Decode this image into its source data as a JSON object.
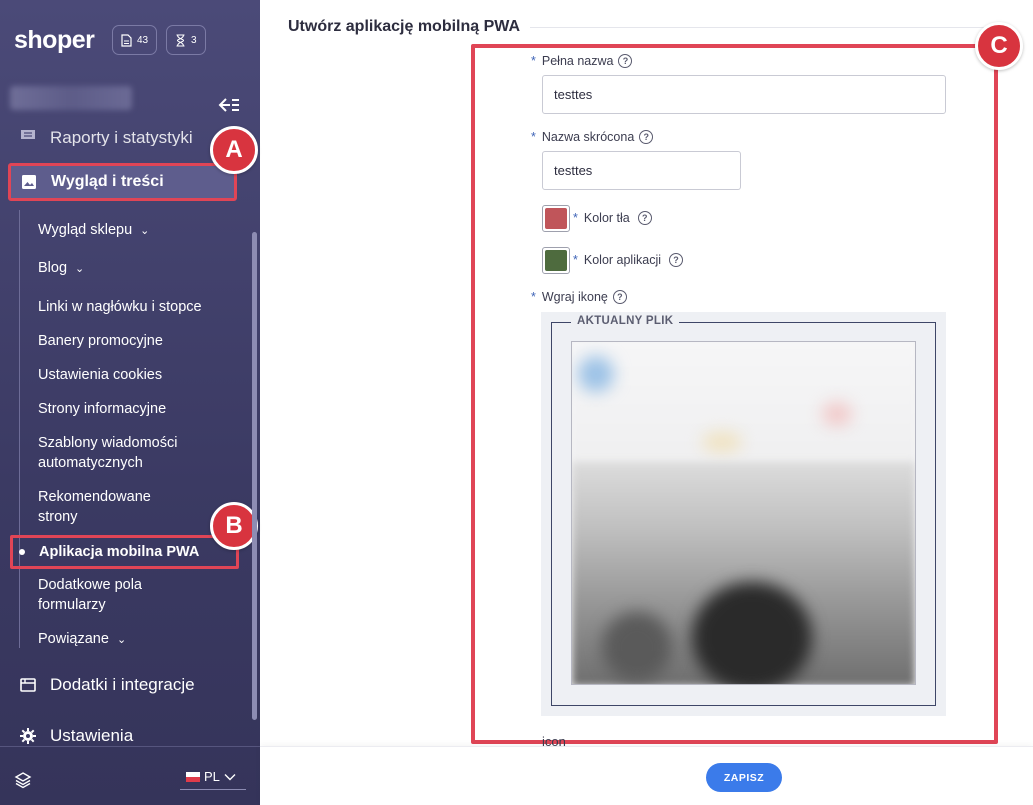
{
  "app": {
    "logo": "shoper"
  },
  "header_pills": [
    {
      "icon": "document-icon",
      "count": "43"
    },
    {
      "icon": "hourglass-icon",
      "count": "3"
    }
  ],
  "sidebar": {
    "top_item": "Raporty i statystyki",
    "active_section": "Wygląd i treści",
    "sub_items": [
      {
        "label": "Wygląd sklepu",
        "chevron": "⌄"
      },
      {
        "label": "Blog",
        "chevron": "⌄"
      },
      {
        "label": "Linki w nagłówku i stopce"
      },
      {
        "label": "Banery promocyjne"
      },
      {
        "label": "Ustawienia cookies"
      },
      {
        "label": "Strony informacyjne"
      },
      {
        "label": "Szablony wiadomości automatycznych"
      },
      {
        "label": "Rekomendowane strony"
      },
      {
        "label": "Aplikacja mobilna PWA"
      },
      {
        "label": "Dodatkowe pola formularzy"
      },
      {
        "label": "Powiązane",
        "chevron": "⌄"
      }
    ],
    "bottom_items": [
      "Dodatki i integracje",
      "Ustawienia"
    ],
    "language": "PL"
  },
  "callouts": {
    "a": "A",
    "b": "B",
    "c": "C"
  },
  "main": {
    "title": "Utwórz aplikację mobilną PWA",
    "required_mark": "*",
    "help_mark": "?",
    "full_name": {
      "label": "Pełna nazwa",
      "value": "testtes"
    },
    "short_name": {
      "label": "Nazwa skrócona",
      "value": "testtes"
    },
    "bg_color": {
      "label": "Kolor tła",
      "value": "#c0555a"
    },
    "app_color": {
      "label": "Kolor aplikacji",
      "value": "#4e6b3e"
    },
    "icon_upload": {
      "label": "Wgraj ikonę",
      "legend": "AKTUALNY PLIK"
    },
    "below_text": "icon",
    "save_label": "ZAPISZ"
  }
}
